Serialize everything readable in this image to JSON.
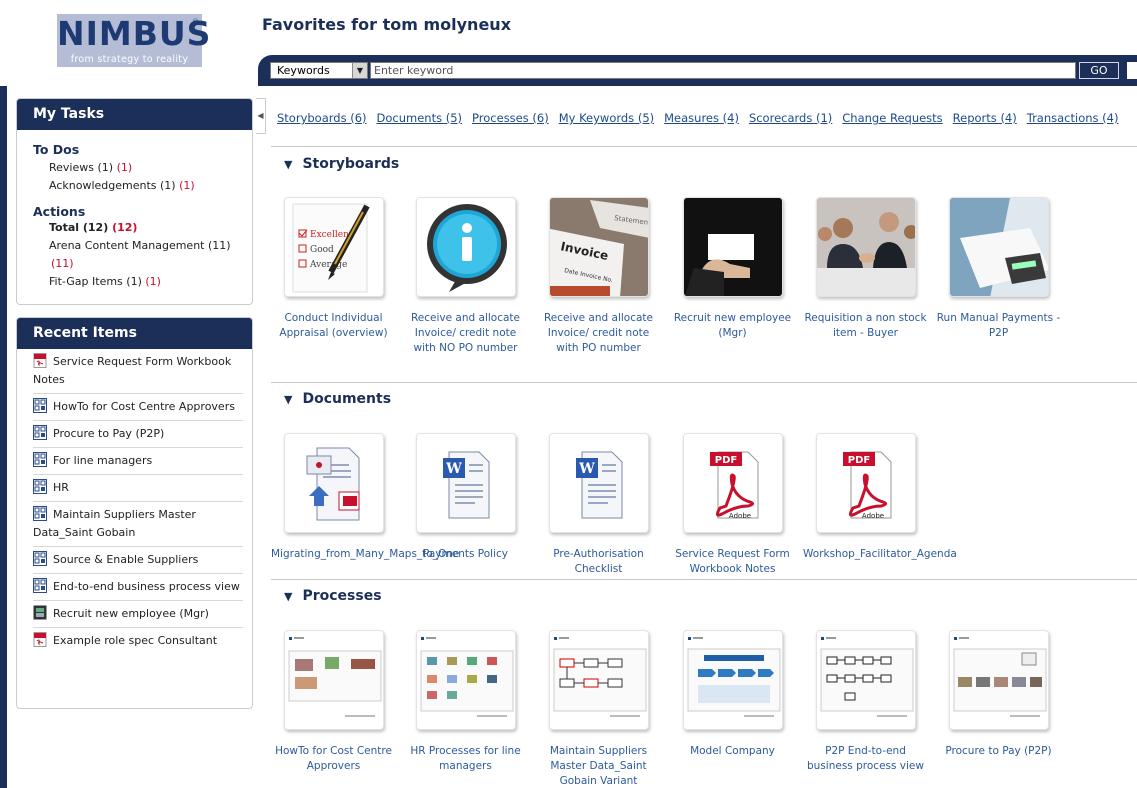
{
  "logo": {
    "name": "NIMBUS",
    "registered": "®",
    "tagline": "from strategy to reality"
  },
  "page_title": "Favorites for tom molyneux",
  "search": {
    "select_value": "Keywords",
    "placeholder": "Enter keyword",
    "go_label": "GO"
  },
  "my_tasks": {
    "title": "My Tasks",
    "todos_heading": "To Dos",
    "todos": [
      {
        "label": "Reviews (1)",
        "count": "(1)"
      },
      {
        "label": "Acknowledgements (1)",
        "count": "(1)"
      }
    ],
    "actions_heading": "Actions",
    "actions": [
      {
        "label": "Total (12)",
        "count": "(12)"
      },
      {
        "label": "Arena Content Management (11)",
        "count": "(11)"
      },
      {
        "label": "Fit-Gap Items (1)",
        "count": "(1)"
      }
    ]
  },
  "recent_items": {
    "title": "Recent Items",
    "items": [
      {
        "label": "Service Request Form Workbook Notes",
        "icon": "pdf-icon"
      },
      {
        "label": "HowTo for Cost Centre Approvers",
        "icon": "process-map-icon"
      },
      {
        "label": "Procure to Pay (P2P)",
        "icon": "process-map-icon"
      },
      {
        "label": "For line managers",
        "icon": "process-map-icon"
      },
      {
        "label": "HR",
        "icon": "process-map-icon"
      },
      {
        "label": "Maintain Suppliers Master Data_Saint Gobain",
        "icon": "process-map-icon"
      },
      {
        "label": "Source & Enable Suppliers",
        "icon": "process-map-icon"
      },
      {
        "label": "End-to-end business process view",
        "icon": "process-map-icon"
      },
      {
        "label": "Recruit new employee (Mgr)",
        "icon": "storyboard-film-icon"
      },
      {
        "label": "Example role spec Consultant",
        "icon": "pdf-icon"
      }
    ]
  },
  "category_links": [
    "Storyboards (6)",
    "Documents (5)",
    "Processes (6)",
    "My Keywords (5)",
    "Measures (4)",
    "Scorecards (1)",
    "Change Requests",
    "Reports (4)",
    "Transactions (4)"
  ],
  "storyboards": {
    "title": "Storyboards",
    "items": [
      {
        "label": "Conduct Individual Appraisal (overview)",
        "icon": "appraisal-checklist-icon"
      },
      {
        "label": "Receive and allocate Invoice/ credit note with NO PO number",
        "icon": "info-icon"
      },
      {
        "label": "Receive and allocate Invoice/ credit note with PO number",
        "icon": "invoice-icon"
      },
      {
        "label": "Recruit new employee (Mgr)",
        "icon": "business-card-icon"
      },
      {
        "label": "Requisition a non stock item - Buyer",
        "icon": "handshake-icon"
      },
      {
        "label": "Run Manual Payments - P2P",
        "icon": "calculator-icon"
      }
    ]
  },
  "documents": {
    "title": "Documents",
    "items": [
      {
        "label": "Migrating_from_Many_Maps_to_One",
        "icon": "powerpoint-doc-icon"
      },
      {
        "label": "Payments Policy",
        "icon": "word-doc-icon"
      },
      {
        "label": "Pre-Authorisation Checklist",
        "icon": "word-doc-icon"
      },
      {
        "label": "Service Request Form Workbook Notes",
        "icon": "pdf-doc-icon"
      },
      {
        "label": "Workshop_Facilitator_Agenda",
        "icon": "pdf-doc-icon"
      }
    ]
  },
  "processes": {
    "title": "Processes",
    "items": [
      {
        "label": "HowTo for Cost Centre Approvers",
        "icon": "process-thumbnail-icon"
      },
      {
        "label": "HR Processes for line managers",
        "icon": "process-thumbnail-icon"
      },
      {
        "label": "Maintain Suppliers Master Data_Saint Gobain Variant",
        "icon": "process-thumbnail-icon"
      },
      {
        "label": "Model Company",
        "icon": "process-thumbnail-icon"
      },
      {
        "label": "P2P End-to-end business process view",
        "icon": "process-thumbnail-icon"
      },
      {
        "label": "Procure to Pay (P2P)",
        "icon": "process-thumbnail-icon"
      }
    ]
  },
  "colors": {
    "navy": "#1b2f58",
    "link": "#1e4a8c",
    "alert": "#c8102e"
  }
}
